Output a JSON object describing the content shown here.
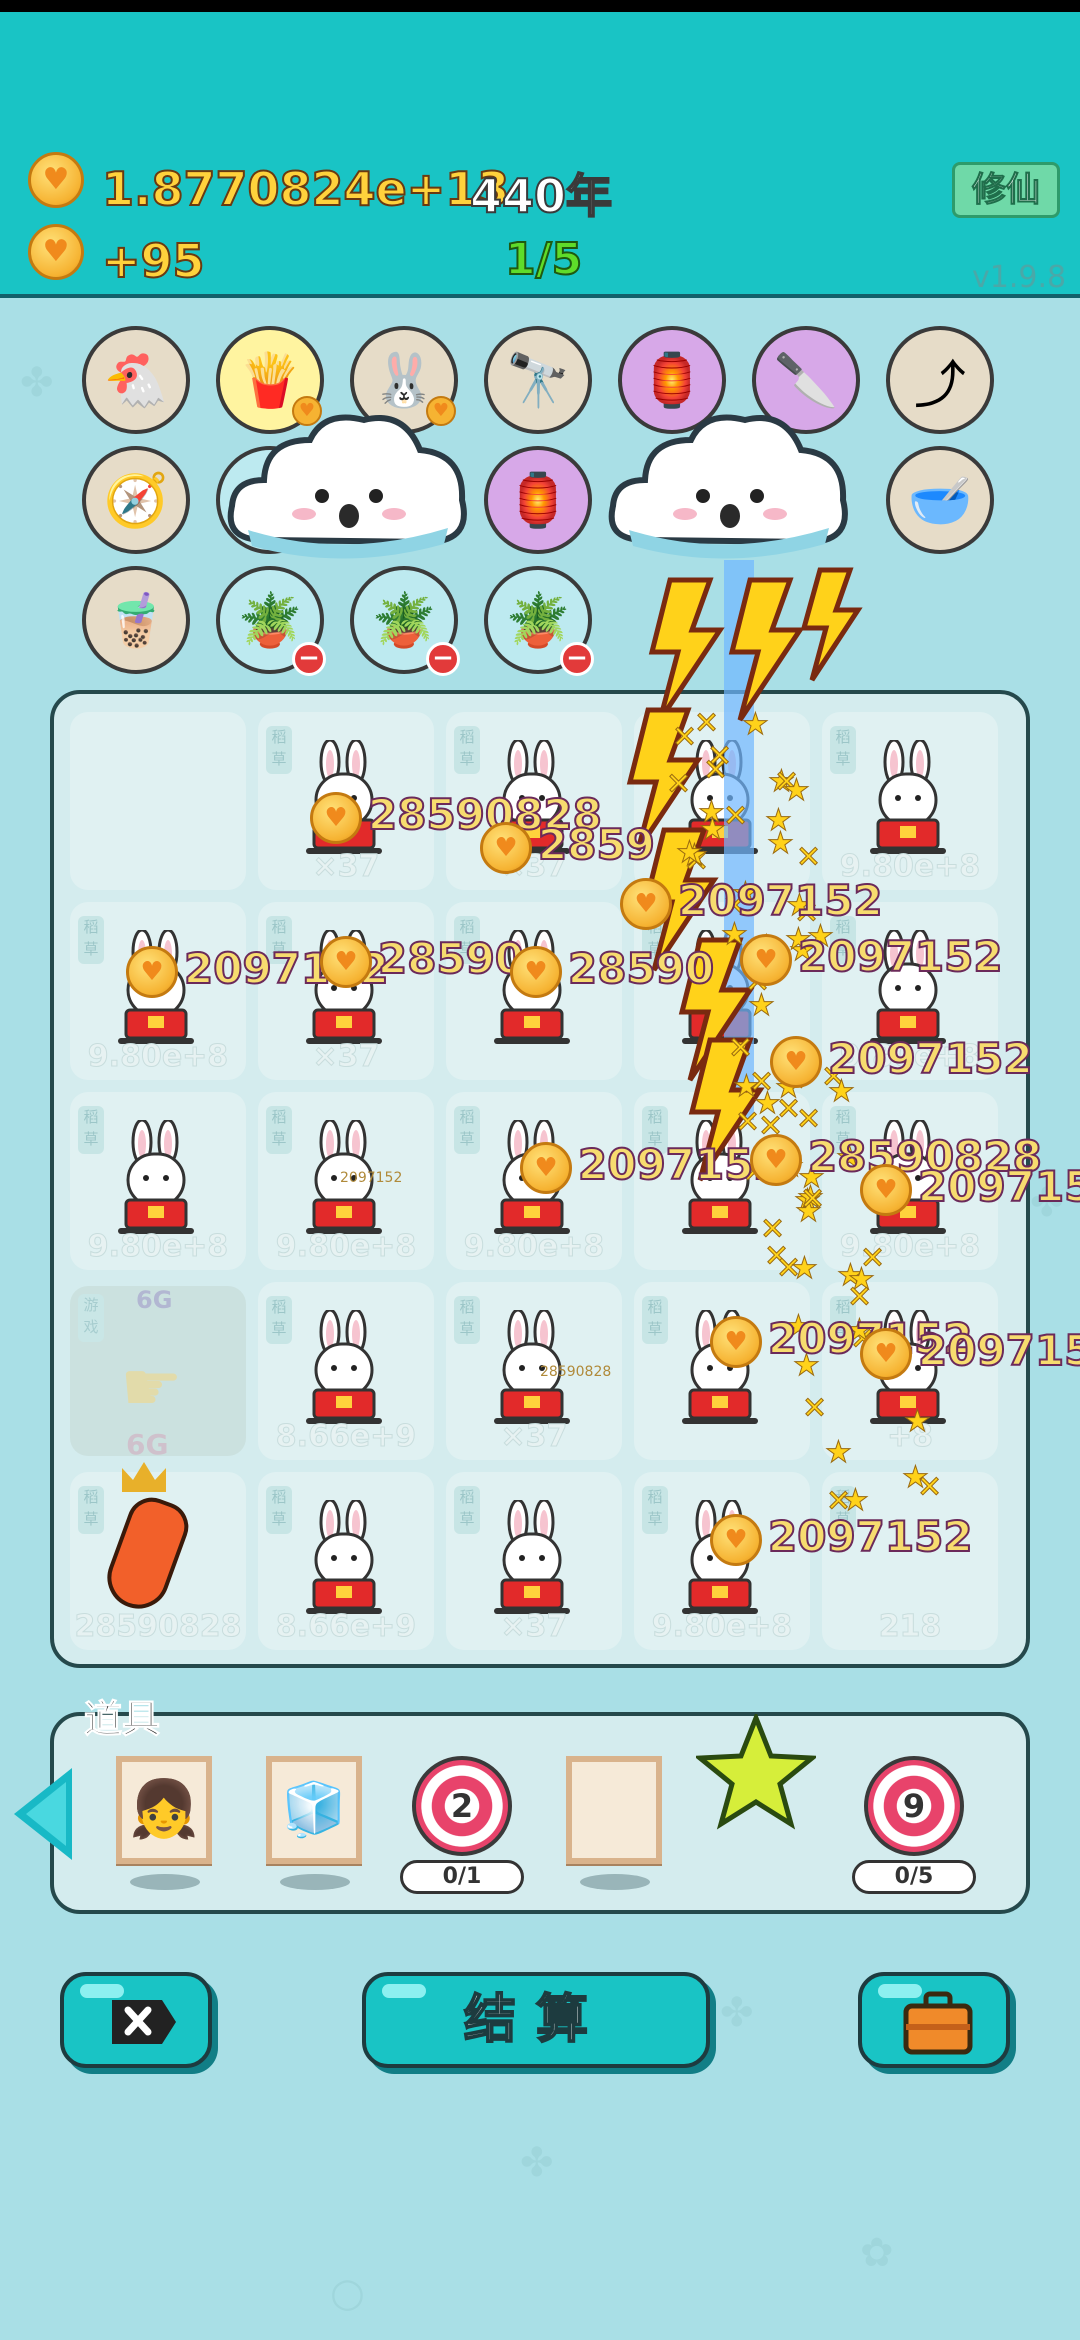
{
  "header": {
    "money": "1.8770824e+13",
    "years": "440年",
    "income": "+95",
    "level_progress": "1/5",
    "xiuxian_label": "修仙",
    "version": "v1.9.8"
  },
  "items": {
    "row1": [
      "chicken-egg-icon",
      "fries-icon",
      "bunny-icon",
      "binoculars-icon",
      "talisman-icon",
      "cleaver-icon",
      "upgrade-arrow-icon"
    ],
    "row2": [
      "compass-icon",
      "flower-pot-icon",
      "talisman-icon",
      "dog-bowl-icon"
    ],
    "row3": [
      "milk-tea-icon",
      "flower-pot-icon",
      "flower-pot-icon",
      "flower-pot-icon"
    ]
  },
  "board": {
    "cell_tag": "稻草",
    "cells": [
      {
        "value": "",
        "label": ""
      },
      {
        "value": "×37"
      },
      {
        "value": "×37"
      },
      {
        "value": ""
      },
      {
        "value": "9.80e+8"
      },
      {
        "value": "9.80e+8"
      },
      {
        "value": "×37"
      },
      {
        "value": ""
      },
      {
        "value": "5."
      },
      {
        "value": "9.80e+8"
      },
      {
        "value": "9.80e+8"
      },
      {
        "value": "9.80e+8"
      },
      {
        "value": "9.80e+8"
      },
      {
        "value": ""
      },
      {
        "value": "9.80e+8"
      },
      {
        "value": ""
      },
      {
        "value": "8.66e+9"
      },
      {
        "value": "×37"
      },
      {
        "value": ""
      },
      {
        "value": "+8"
      },
      {
        "value": "28590828"
      },
      {
        "value": "8.66e+9"
      },
      {
        "value": "×37"
      },
      {
        "value": "9.80e+8"
      },
      {
        "value": "218"
      }
    ],
    "hand_cell_tag": "游戏",
    "hand_cell_badge": "6G",
    "carrot_badge": "6G",
    "small_labels": [
      "2097152",
      "28590828"
    ],
    "floating_numbers": [
      "28590828",
      "2859",
      "2097152",
      "2097152",
      "28590",
      "28590",
      "2097152",
      "2097152",
      "2097152",
      "28590828",
      "2097152",
      "2097152",
      "2097152",
      "2097152"
    ]
  },
  "tools": {
    "label": "道具",
    "target1_number": "2",
    "target1_count": "0/1",
    "target2_number": "9",
    "target2_count": "0/5"
  },
  "bottom": {
    "settle_label": "结算"
  }
}
